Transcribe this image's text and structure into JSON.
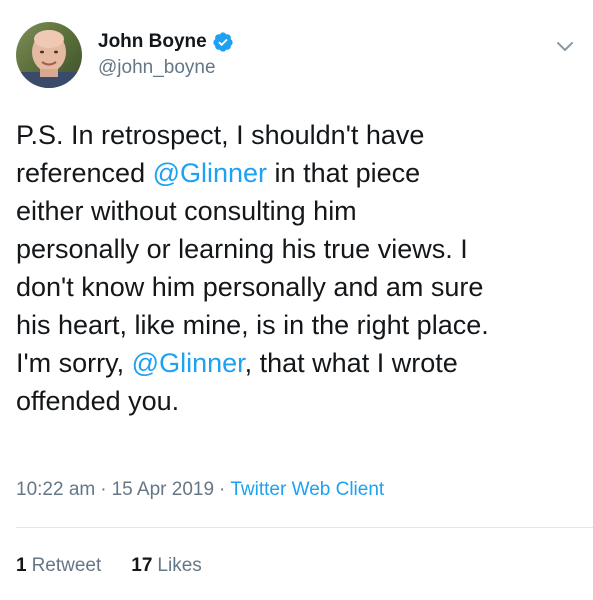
{
  "author": {
    "display_name": "John Boyne",
    "handle": "@john_boyne",
    "verified": true
  },
  "tweet": {
    "lines": [
      [
        {
          "text": "P.S. In retrospect, I shouldn't have",
          "type": "text"
        }
      ],
      [
        {
          "text": "referenced ",
          "type": "text"
        },
        {
          "text": "@Glinner",
          "type": "mention"
        },
        {
          "text": " in that piece",
          "type": "text"
        }
      ],
      [
        {
          "text": "either without consulting him",
          "type": "text"
        }
      ],
      [
        {
          "text": "personally or learning his true views. I",
          "type": "text"
        }
      ],
      [
        {
          "text": "don't know him personally and am sure",
          "type": "text"
        }
      ],
      [
        {
          "text": "his heart, like mine, is in the right place.",
          "type": "text"
        }
      ],
      [
        {
          "text": "I'm sorry, ",
          "type": "text"
        },
        {
          "text": "@Glinner",
          "type": "mention"
        },
        {
          "text": ", that what I wrote",
          "type": "text"
        }
      ],
      [
        {
          "text": "offended you.",
          "type": "text"
        }
      ]
    ]
  },
  "meta": {
    "time": "10:22 am",
    "separator": "·",
    "date": "15 Apr 2019",
    "client": "Twitter Web Client"
  },
  "stats": {
    "retweets_count": "1",
    "retweets_label": "Retweet",
    "likes_count": "17",
    "likes_label": "Likes"
  },
  "colors": {
    "accent": "#1da1f2",
    "secondary_text": "#657786",
    "primary_text": "#14171a",
    "divider": "#e1e8ed"
  },
  "icons": {
    "verified": "verified-badge-icon",
    "caret": "chevron-down-icon"
  }
}
